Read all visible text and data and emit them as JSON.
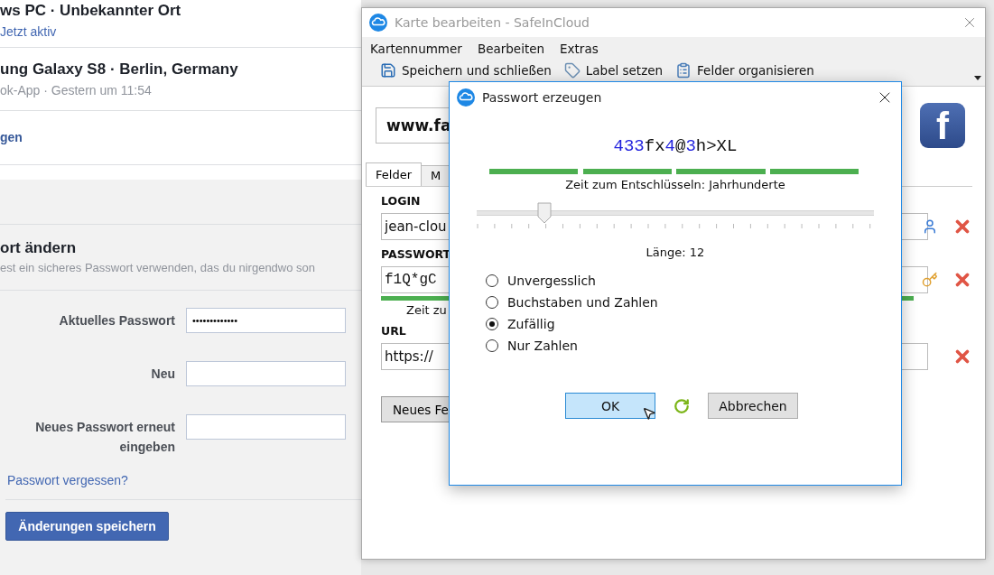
{
  "background_page": {
    "sessions": [
      {
        "device": "ws PC · Unbekannter Ort",
        "detail": "Jetzt aktiv",
        "kind": "active"
      },
      {
        "device": "ung Galaxy S8 · Berlin, Germany",
        "detail": "ok-App · Gestern um 11:54",
        "kind": "past"
      }
    ],
    "link": "gen",
    "section": {
      "title": "ort ändern",
      "description": "est ein sicheres Passwort verwenden, das du nirgendwo son"
    },
    "fields": [
      {
        "label": "Aktuelles Passwort",
        "value": "•••••••••••••"
      },
      {
        "label": "Neu"
      },
      {
        "label": "Neues Passwort erneut eingeben"
      }
    ],
    "forgot_link": "Passwort vergessen?",
    "save_button": "Änderungen speichern"
  },
  "card_window": {
    "title": "Karte bearbeiten - SafeInCloud",
    "menu": [
      "Kartennummer",
      "Bearbeiten",
      "Extras"
    ],
    "toolbar": [
      {
        "label": "Speichern und schließen",
        "kind": "save"
      },
      {
        "label": "Label setzen",
        "kind": "label"
      },
      {
        "label": "Felder organisieren",
        "kind": "organize"
      }
    ],
    "card_title": "www.fa",
    "logo": "f",
    "tabs": [
      {
        "label": "Felder",
        "selected": true
      },
      {
        "label": "M",
        "selected": false
      }
    ],
    "fields": [
      {
        "label": "LOGIN",
        "value": "jean-clou",
        "kind": "login"
      },
      {
        "label": "PASSWORT",
        "value": "f1Q*gC",
        "kind": "password",
        "strength": {
          "level": 1,
          "text": "Zeit zu"
        }
      },
      {
        "label": "URL",
        "value": "https://",
        "kind": "url"
      }
    ],
    "add_field_button": "Neues Fe"
  },
  "dialog": {
    "title": "Passwort erzeugen",
    "password": [
      {
        "text": "433",
        "kind": "digit"
      },
      {
        "text": "fx",
        "kind": "other"
      },
      {
        "text": "4",
        "kind": "digit"
      },
      {
        "text": "@",
        "kind": "other"
      },
      {
        "text": "3",
        "kind": "digit"
      },
      {
        "text": "h>XL",
        "kind": "other"
      }
    ],
    "strength": {
      "level": 1,
      "text": "Zeit zum Entschlüsseln: Jahrhunderte"
    },
    "length": {
      "level": 0.17,
      "text": "Länge: 12"
    },
    "options": [
      {
        "label": "Unvergesslich",
        "selected": false
      },
      {
        "label": "Buchstaben und Zahlen",
        "selected": false
      },
      {
        "label": "Zufällig",
        "selected": true
      },
      {
        "label": "Nur Zahlen",
        "selected": false
      }
    ],
    "buttons": [
      {
        "label": "OK",
        "kind": "default"
      },
      {
        "kind": "regenerate"
      },
      {
        "label": "Abbrechen",
        "kind": "normal"
      }
    ]
  }
}
